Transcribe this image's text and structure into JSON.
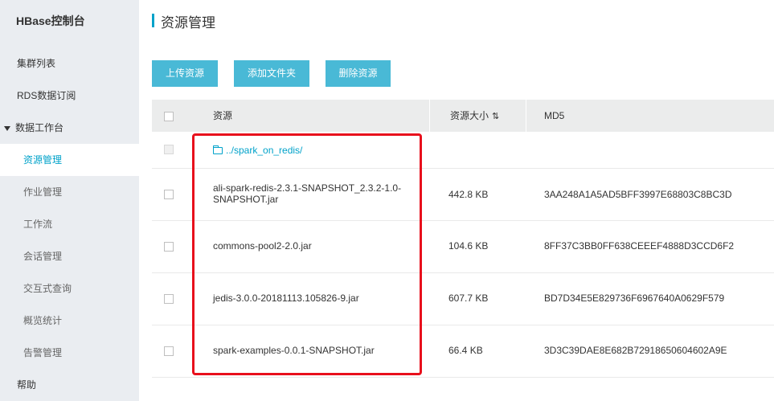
{
  "sidebar": {
    "title": "HBase控制台",
    "items": [
      {
        "label": "集群列表"
      },
      {
        "label": "RDS数据订阅"
      },
      {
        "label": "数据工作台"
      },
      {
        "label": "资源管理"
      },
      {
        "label": "作业管理"
      },
      {
        "label": "工作流"
      },
      {
        "label": "会话管理"
      },
      {
        "label": "交互式查询"
      },
      {
        "label": "概览统计"
      },
      {
        "label": "告警管理"
      },
      {
        "label": "帮助"
      }
    ]
  },
  "page": {
    "title": "资源管理"
  },
  "toolbar": {
    "upload_label": "上传资源",
    "add_folder_label": "添加文件夹",
    "delete_label": "删除资源"
  },
  "table": {
    "headers": {
      "resource": "资源",
      "size": "资源大小",
      "md5": "MD5"
    },
    "parent_folder": "../spark_on_redis/",
    "rows": [
      {
        "name": "ali-spark-redis-2.3.1-SNAPSHOT_2.3.2-1.0-SNAPSHOT.jar",
        "size": "442.8 KB",
        "md5": "3AA248A1A5AD5BFF3997E68803C8BC3D"
      },
      {
        "name": "commons-pool2-2.0.jar",
        "size": "104.6 KB",
        "md5": "8FF37C3BB0FF638CEEEF4888D3CCD6F2"
      },
      {
        "name": "jedis-3.0.0-20181113.105826-9.jar",
        "size": "607.7 KB",
        "md5": "BD7D34E5E829736F6967640A0629F579"
      },
      {
        "name": "spark-examples-0.0.1-SNAPSHOT.jar",
        "size": "66.4 KB",
        "md5": "3D3C39DAE8E682B72918650604602A9E"
      }
    ]
  },
  "colors": {
    "accent": "#00a2ca",
    "button": "#49b9d6",
    "highlight": "#e8101c",
    "sidebar_bg": "#eaedf1"
  }
}
